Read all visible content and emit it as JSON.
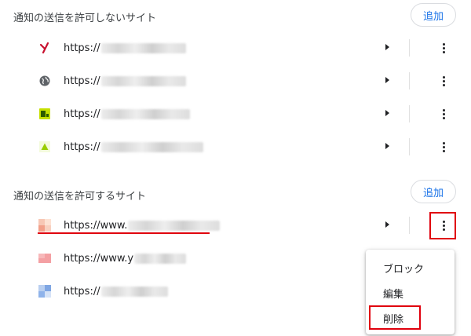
{
  "blocked_section": {
    "title": "通知の送信を許可しないサイト",
    "add_label": "追加",
    "sites": [
      {
        "url": "https://",
        "icon": "y-letter-icon"
      },
      {
        "url": "https://",
        "icon": "globe-icon"
      },
      {
        "url": "https://",
        "icon": "green-badge-icon"
      },
      {
        "url": "https://",
        "icon": "triangle-icon"
      }
    ]
  },
  "allowed_section": {
    "title": "通知の送信を許可するサイト",
    "add_label": "追加",
    "sites": [
      {
        "url": "https://www.",
        "icon": "pixel-favicon-icon"
      },
      {
        "url": "https://www.y",
        "icon": "pink-favicon-icon"
      },
      {
        "url": "https://",
        "icon": "blue-favicon-icon"
      }
    ]
  },
  "context_menu": {
    "items": [
      "ブロック",
      "編集",
      "削除"
    ]
  },
  "colors": {
    "highlight": "#e0000d",
    "accent": "#1a73e8"
  }
}
